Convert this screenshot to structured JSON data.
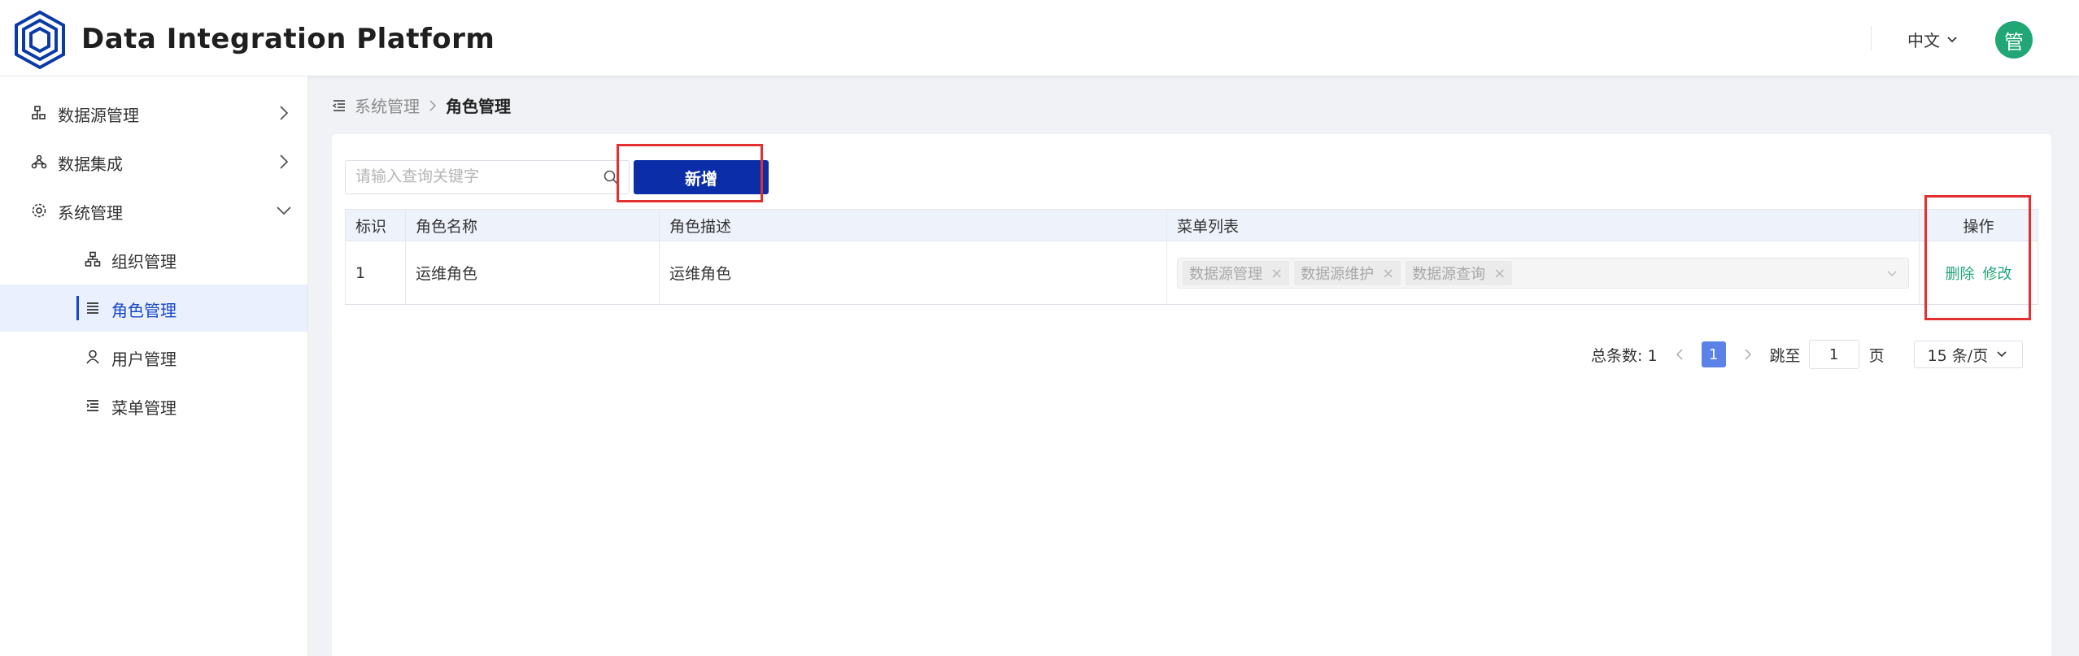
{
  "header": {
    "title": "Data Integration Platform",
    "language": "中文",
    "avatar_text": "管",
    "avatar_color": "#21a675"
  },
  "sidebar": {
    "items": [
      {
        "label": "数据源管理",
        "icon": "datasource-icon"
      },
      {
        "label": "数据集成",
        "icon": "integration-icon"
      },
      {
        "label": "系统管理",
        "icon": "gear-icon"
      }
    ],
    "sub_items": [
      {
        "label": "组织管理",
        "icon": "org-icon"
      },
      {
        "label": "角色管理",
        "icon": "list-icon",
        "active": true
      },
      {
        "label": "用户管理",
        "icon": "user-icon"
      },
      {
        "label": "菜单管理",
        "icon": "menu-icon"
      }
    ]
  },
  "breadcrumb": {
    "parent": "系统管理",
    "current": "角色管理"
  },
  "toolbar": {
    "search_placeholder": "请输入查询关键字",
    "add_label": "新增"
  },
  "table": {
    "headers": [
      "标识",
      "角色名称",
      "角色描述",
      "菜单列表",
      "操作"
    ],
    "rows": [
      {
        "id": "1",
        "name": "运维角色",
        "description": "运维角色",
        "menus": [
          "数据源管理",
          "数据源维护",
          "数据源查询"
        ],
        "actions": [
          "删除",
          "修改"
        ]
      }
    ]
  },
  "pagination": {
    "total_label": "总条数:",
    "total": "1",
    "current_page": "1",
    "goto_label": "跳至",
    "goto_value": "1",
    "page_suffix": "页",
    "page_size": "15 条/页"
  },
  "colors": {
    "accent": "#0b2da8",
    "active": "#1747c6",
    "success": "#21a675",
    "highlight": "#e23030"
  }
}
